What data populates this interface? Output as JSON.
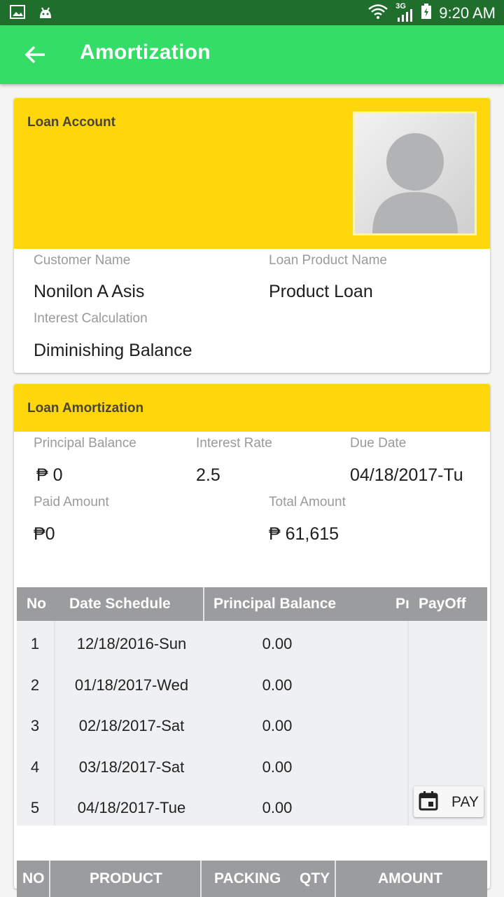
{
  "status_bar": {
    "time": "9:20 AM",
    "network": "3G",
    "icons": [
      "image-icon",
      "android-icon",
      "wifi-icon",
      "signal-icon",
      "battery-icon"
    ]
  },
  "app_bar": {
    "title": "Amortization",
    "back_icon": "arrow-left-icon"
  },
  "loan_account": {
    "title": "Loan Account",
    "customer_name_label": "Customer Name",
    "customer_name": "Nonilon A Asis",
    "product_label": "Loan Product Name",
    "product": "Product Loan",
    "interest_calc_label": "Interest Calculation",
    "interest_calc": "Diminishing Balance"
  },
  "loan_amortization": {
    "title": "Loan Amortization",
    "principal_label": "Principal Balance",
    "principal": "₱ 0",
    "rate_label": "Interest Rate",
    "rate": "2.5",
    "due_label": "Due Date",
    "due": "04/18/2017-Tu",
    "paid_label": "Paid Amount",
    "paid": "₱0",
    "total_label": "Total Amount",
    "total": "₱ 61,615"
  },
  "schedule": {
    "headers": {
      "no": "No",
      "date": "Date Schedule",
      "balance": "Principal Balance",
      "pr": "Pı",
      "payoff": "PayOff"
    },
    "rows": [
      {
        "no": "1",
        "date": "12/18/2016-Sun",
        "balance": "0.00"
      },
      {
        "no": "2",
        "date": "01/18/2017-Wed",
        "balance": "0.00"
      },
      {
        "no": "3",
        "date": "02/18/2017-Sat",
        "balance": "0.00"
      },
      {
        "no": "4",
        "date": "03/18/2017-Sat",
        "balance": "0.00"
      },
      {
        "no": "5",
        "date": "04/18/2017-Tue",
        "balance": "0.00"
      }
    ],
    "pay_label": "PAY"
  },
  "products": {
    "headers": {
      "no": "NO",
      "product": "PRODUCT",
      "packing": "PACKING",
      "qty": "QTY",
      "amount": "AMOUNT"
    }
  },
  "colors": {
    "status_bar": "#1f6e2c",
    "app_bar": "#33dd66",
    "card_header": "#ffd60a",
    "table_header": "#9b9c9e"
  }
}
